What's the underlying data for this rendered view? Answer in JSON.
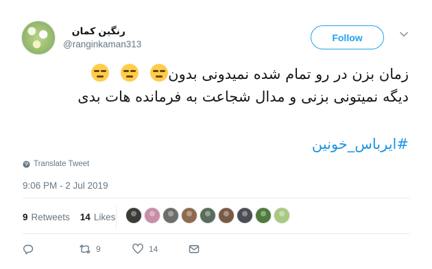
{
  "user": {
    "display_name": "رنگین کمان",
    "handle": "@ranginkaman313"
  },
  "follow_label": "Follow",
  "tweet": {
    "line1": "زمان بزن در رو تمام شده نمیدونی بدون",
    "line2": "دیگه نمیتونی بزنی و مدال شجاعت به فرمانده هات بدی",
    "emoji_count": 3,
    "hashtag": "#ایرباس_خونین"
  },
  "translate_label": "Translate Tweet",
  "timestamp": "9:06 PM - 2 Jul 2019",
  "stats": {
    "retweets_count": "9",
    "retweets_label": "Retweets",
    "likes_count": "14",
    "likes_label": "Likes"
  },
  "likers": [
    {
      "color": "#3b3a35"
    },
    {
      "color": "#c98da6"
    },
    {
      "color": "#6d6d6a"
    },
    {
      "color": "#8e6a4f"
    },
    {
      "color": "#5a6c5a"
    },
    {
      "color": "#7b5a44"
    },
    {
      "color": "#4a4e52"
    },
    {
      "color": "#4f7a3b"
    },
    {
      "color": "#a9c982"
    }
  ],
  "actions": {
    "reply_icon": "reply-icon",
    "retweet_count": "9",
    "like_count": "14",
    "dm_icon": "direct-message-icon"
  },
  "colors": {
    "accent": "#1da1f2",
    "link": "#1b95e0",
    "muted": "#657786"
  }
}
